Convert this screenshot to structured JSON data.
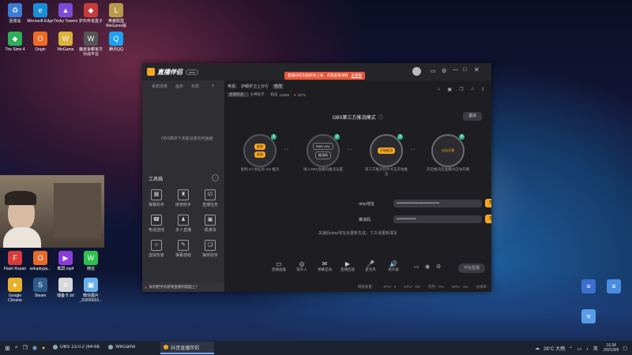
{
  "desktop_icons_left": [
    {
      "label": "回收站",
      "color": "#3b7dd8",
      "icon": "recycle-bin-icon",
      "glyph": "♻"
    },
    {
      "label": "Microsoft Edge",
      "color": "#1a8fd8",
      "icon": "edge-icon",
      "glyph": "e"
    },
    {
      "label": "Tricky Towers",
      "color": "#7b4bd6",
      "icon": "game-icon",
      "glyph": "▲"
    },
    {
      "label": "护石传说盒子",
      "color": "#c43b3b",
      "icon": "app-icon",
      "glyph": "◆"
    },
    {
      "label": "英雄联盟 WeGame版",
      "color": "#b89b4a",
      "icon": "lol-icon",
      "glyph": "L"
    },
    {
      "label": "The Sims 4",
      "color": "#2fae5a",
      "icon": "sims-icon",
      "glyph": "◆"
    },
    {
      "label": "Origin",
      "color": "#f06a25",
      "icon": "origin-icon",
      "glyph": "O"
    },
    {
      "label": "WeGame",
      "color": "#d9b23b",
      "icon": "wegame-icon",
      "glyph": "W"
    },
    {
      "label": "魔兽争霸官方对战平台",
      "color": "#555",
      "icon": "warcraft-icon",
      "glyph": "W"
    },
    {
      "label": "腾讯QQ",
      "color": "#1da1f2",
      "icon": "qq-icon",
      "glyph": "Q"
    },
    {
      "label": "Flash Repair",
      "color": "#d83b3b",
      "icon": "flash-repair-icon",
      "glyph": "F"
    },
    {
      "label": "setupkypa...",
      "color": "#e86a2b",
      "icon": "office-icon",
      "glyph": "O"
    },
    {
      "label": "截屏.mp4",
      "color": "#8c3bd8",
      "icon": "video-icon",
      "glyph": "▶"
    },
    {
      "label": "微信",
      "color": "#2fbf4f",
      "icon": "wechat-icon",
      "glyph": "W"
    },
    {
      "label": "Google Chrome",
      "color": "#e8b12b",
      "icon": "chrome-icon",
      "glyph": "●"
    },
    {
      "label": "Steam",
      "color": "#2c5b8c",
      "icon": "steam-icon",
      "glyph": "S"
    },
    {
      "label": "储备卡.txt",
      "color": "#d8d8d8",
      "icon": "text-file-icon",
      "glyph": "≡"
    },
    {
      "label": "微信图片_20200601...",
      "color": "#6ab0e8",
      "icon": "image-file-icon",
      "glyph": "▣"
    }
  ],
  "desktop_icons_right": [
    {
      "label": "",
      "color": "#3c6fd0",
      "icon": "document-icon",
      "glyph": "≡"
    },
    {
      "label": "",
      "color": "#4a8ce0",
      "icon": "document-icon",
      "glyph": "≡"
    },
    {
      "label": "",
      "color": "#5a9ce8",
      "icon": "document-icon",
      "glyph": "≡"
    }
  ],
  "window": {
    "app_name": "直播伴侣",
    "version_badge": "beta",
    "notice": "直播间的功能即将上线，点我查看详情",
    "notice_button": "去看看",
    "top_tabs": [
      "系统场景",
      "画布",
      "布局"
    ],
    "stream_title_label": "电视：",
    "stream_title": "护眼护卫上分行",
    "stream_tag": "修改",
    "category_label": "直播频道：",
    "category": "大神陪学",
    "fans_label": "粉丝",
    "fans_count": "12306",
    "likes_count": "3174",
    "mode_title": "OBS第三方推流模式",
    "exit_button": "退出",
    "left_empty_hint": "OBS推流下未能设置任何画面",
    "tools_header": "工具箱",
    "tools": [
      {
        "label": "弹幕助手",
        "glyph": "▦"
      },
      {
        "label": "房管助手",
        "glyph": "♜"
      },
      {
        "label": "直播任务",
        "glyph": "☑"
      },
      {
        "label": "电话连线",
        "glyph": "☎"
      },
      {
        "label": "多人直播",
        "glyph": "♟"
      },
      {
        "label": "观演场",
        "glyph": "▣"
      },
      {
        "label": "虚拟形象",
        "glyph": "☺"
      },
      {
        "label": "弹幕游戏",
        "glyph": "✎"
      },
      {
        "label": "抽奖助手",
        "glyph": "❏"
      }
    ],
    "steps": [
      {
        "pills": [
          "复制",
          "复制"
        ],
        "caption": "复制 url 地址到 obs 推流",
        "num": "1"
      },
      {
        "pills": [
          "RMS URL",
          "推流码"
        ],
        "caption": "填入OBS直播的推流设置",
        "num": "2"
      },
      {
        "pills": [
          "开始推流"
        ],
        "caption": "第三方推流软件点击开始推流",
        "num": "3"
      },
      {
        "pills": [
          "自动开播"
        ],
        "caption": "开启推流后直播间自动开播",
        "num": "4"
      }
    ],
    "rtmp_label": "rtmp地址",
    "rtmp_value": "•••••••••••••••••••••••••••••••",
    "rtmp_copy": "复制",
    "key_label": "推流码",
    "key_value": "••••••••••••••",
    "key_copy": "复制",
    "footer_hint": "关播后rtmp地址会重新生成，下次请重新填写",
    "bottom_buttons": [
      {
        "label": "直播画面",
        "glyph": "▭"
      },
      {
        "label": "观众入",
        "glyph": "◎"
      },
      {
        "label": "弹幕互动",
        "glyph": "✉"
      },
      {
        "label": "直播回放",
        "glyph": "▶"
      },
      {
        "label": "麦克风",
        "glyph": "🎤"
      },
      {
        "label": "扬声器",
        "glyph": "🔊"
      }
    ],
    "start_button": "开始直播",
    "bottom_notice": "如何把手机游戏直播到电脑上？",
    "status_items": [
      "网络质量：",
      "FPS：0",
      "CPU：0%",
      "内存：0%",
      "GPU：0%",
      "分辨率"
    ]
  },
  "taskbar": {
    "items": [
      {
        "label": "OBS 23.0.2 (64-bit...",
        "active": false
      },
      {
        "label": "WeGame",
        "active": false
      },
      {
        "label": "抖音直播伴侣",
        "active": true
      }
    ],
    "weather": "28°C 大雨",
    "time": "16:34",
    "date": "2021/9/6"
  }
}
